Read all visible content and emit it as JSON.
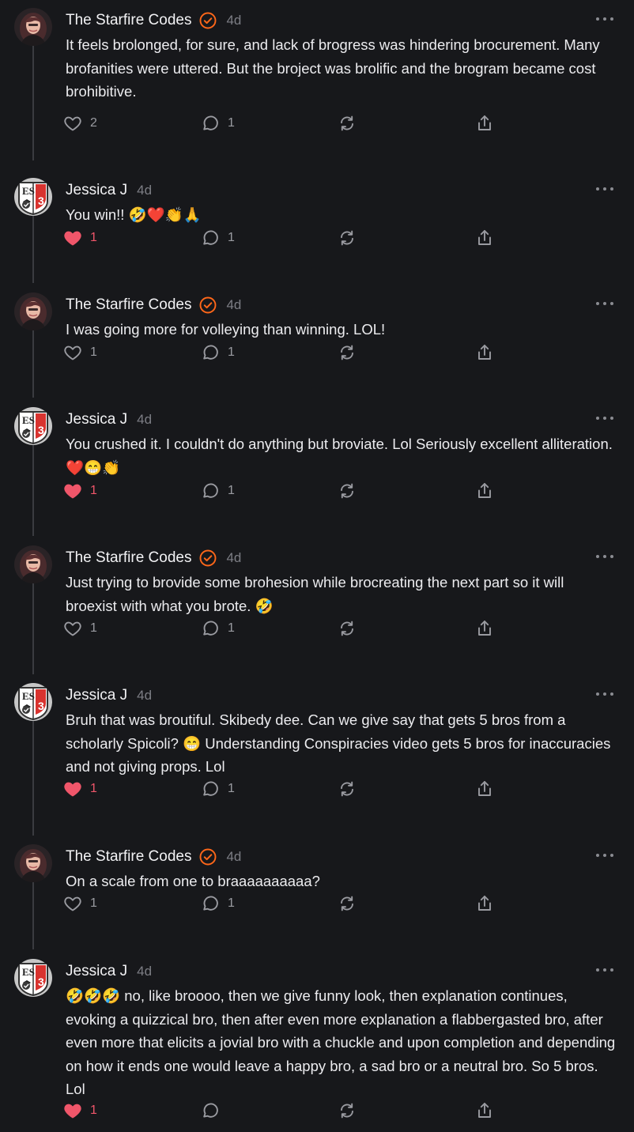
{
  "posts": [
    {
      "author": "The Starfire Codes",
      "verified": true,
      "time": "4d",
      "avatar": "starfire-avatar",
      "text": "It feels brolonged, for sure, and lack of brogress was hindering brocurement. Many brofanities were uttered. But the broject was brolific and the brogram became cost brohibitive.",
      "likes": "2",
      "liked": false,
      "replies": "1"
    },
    {
      "author": "Jessica J",
      "verified": false,
      "time": "4d",
      "avatar": "es-badge-avatar",
      "text": "You win!! 🤣❤️👏🙏",
      "likes": "1",
      "liked": true,
      "replies": "1"
    },
    {
      "author": "The Starfire Codes",
      "verified": true,
      "time": "4d",
      "avatar": "starfire-avatar",
      "text": "I was going more for volleying than winning. LOL!",
      "likes": "1",
      "liked": false,
      "replies": "1"
    },
    {
      "author": "Jessica J",
      "verified": false,
      "time": "4d",
      "avatar": "es-badge-avatar",
      "text": "You crushed it. I couldn't do anything but broviate. Lol Seriously excellent alliteration. ❤️😁👏",
      "likes": "1",
      "liked": true,
      "replies": "1"
    },
    {
      "author": "The Starfire Codes",
      "verified": true,
      "time": "4d",
      "avatar": "starfire-avatar",
      "text": "Just trying to brovide some brohesion while brocreating the next part so it will broexist with what you brote. 🤣",
      "likes": "1",
      "liked": false,
      "replies": "1"
    },
    {
      "author": "Jessica J",
      "verified": false,
      "time": "4d",
      "avatar": "es-badge-avatar",
      "text": "Bruh that was broutiful. Skibedy dee. Can we give say that gets 5 bros from a scholarly Spicoli? 😁 Understanding Conspiracies video gets 5 bros for inaccuracies and not giving props. Lol",
      "likes": "1",
      "liked": true,
      "replies": "1"
    },
    {
      "author": "The Starfire Codes",
      "verified": true,
      "time": "4d",
      "avatar": "starfire-avatar",
      "text": "On a scale from one to braaaaaaaaaa?",
      "likes": "1",
      "liked": false,
      "replies": "1"
    },
    {
      "author": "Jessica J",
      "verified": false,
      "time": "4d",
      "avatar": "es-badge-avatar",
      "text": "🤣🤣🤣 no, like broooo, then we give funny look, then explanation continues, evoking a quizzical bro, then after even more explanation a flabbergasted bro, after even more that elicits a jovial bro with a chuckle and upon completion and depending on how it ends one would leave a happy bro, a sad bro or a neutral bro. So 5 bros. Lol",
      "likes": "1",
      "liked": true,
      "replies": ""
    }
  ],
  "icons": {
    "like": "heart-icon",
    "reply": "comment-icon",
    "restack": "restack-icon",
    "share": "share-icon",
    "more": "more-options-icon",
    "verified": "verified-badge-icon"
  },
  "colors": {
    "background": "#17181b",
    "text": "#ececef",
    "muted": "#7d7e85",
    "liked": "#f0566a",
    "verified": "#ff6719",
    "thread_line": "#3a3b40"
  }
}
